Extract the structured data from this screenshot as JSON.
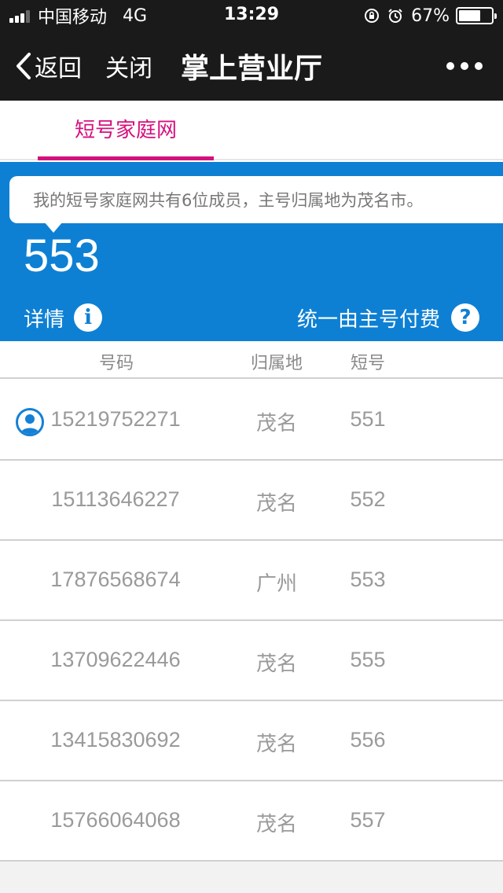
{
  "status_bar": {
    "carrier": "中国移动",
    "network": "4G",
    "time": "13:29",
    "battery_percent": "67%",
    "battery_level": 0.67,
    "icons": [
      "signal-icon",
      "lock-rotation-icon",
      "alarm-icon",
      "battery-icon"
    ]
  },
  "nav": {
    "back_label": "返回",
    "close_label": "关闭",
    "title": "掌上营业厅",
    "more_icon": "more-icon"
  },
  "tabs": [
    {
      "label": "短号家庭网",
      "active": true
    }
  ],
  "panel": {
    "notice": "我的短号家庭网共有6位成员，主号归属地为茂名市。",
    "short_number": "553",
    "detail_label": "详情",
    "pay_label": "统一由主号付费",
    "info_icon": "info-icon",
    "help_icon": "help-icon"
  },
  "table": {
    "headers": [
      "号码",
      "归属地",
      "短号"
    ],
    "rows": [
      {
        "number": "15219752271",
        "region": "茂名",
        "short": "551",
        "is_main": true
      },
      {
        "number": "15113646227",
        "region": "茂名",
        "short": "552"
      },
      {
        "number": "17876568674",
        "region": "广州",
        "short": "553"
      },
      {
        "number": "13709622446",
        "region": "茂名",
        "short": "555"
      },
      {
        "number": "13415830692",
        "region": "茂名",
        "short": "556"
      },
      {
        "number": "15766064068",
        "region": "茂名",
        "short": "557"
      }
    ]
  },
  "colors": {
    "accent": "#d5117e",
    "panel_blue": "#0e80d4",
    "nav_bg": "#1a1a1a"
  }
}
